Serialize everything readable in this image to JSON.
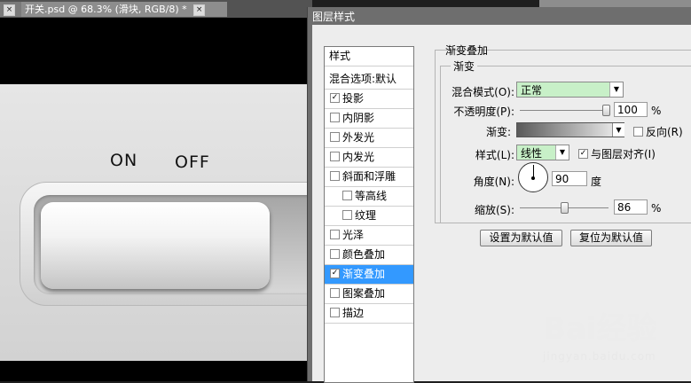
{
  "tabs": [
    {
      "close": "×",
      "label": "",
      "active": false
    },
    {
      "close": "×",
      "label": "开关.psd @ 68.3% (滑块, RGB/8) *",
      "active": true
    }
  ],
  "canvas": {
    "on_label": "ON",
    "off_label": "OFF"
  },
  "dialog": {
    "title": "图层样式",
    "style_list": {
      "header": "样式",
      "blend_default": "混合选项:默认",
      "items": [
        {
          "label": "投影",
          "checked": true
        },
        {
          "label": "内阴影",
          "checked": false
        },
        {
          "label": "外发光",
          "checked": false
        },
        {
          "label": "内发光",
          "checked": false
        },
        {
          "label": "斜面和浮雕",
          "checked": false
        },
        {
          "label": "等高线",
          "checked": false,
          "sub": true
        },
        {
          "label": "纹理",
          "checked": false,
          "sub": true
        },
        {
          "label": "光泽",
          "checked": false
        },
        {
          "label": "颜色叠加",
          "checked": false
        },
        {
          "label": "渐变叠加",
          "checked": true,
          "selected": true
        },
        {
          "label": "图案叠加",
          "checked": false
        },
        {
          "label": "描边",
          "checked": false
        }
      ]
    },
    "panel": {
      "group_title": "渐变叠加",
      "sub_title": "渐变",
      "blend_mode_label": "混合模式(O):",
      "blend_mode_value": "正常",
      "opacity_label": "不透明度(P):",
      "opacity_value": "100",
      "opacity_unit": "%",
      "gradient_label": "渐变:",
      "reverse_label": "反向(R)",
      "style_label": "样式(L):",
      "style_value": "线性",
      "align_label": "与图层对齐(I)",
      "angle_label": "角度(N):",
      "angle_value": "90",
      "angle_unit": "度",
      "scale_label": "缩放(S):",
      "scale_value": "86",
      "scale_unit": "%",
      "set_default": "设置为默认值",
      "reset_default": "复位为默认值"
    }
  },
  "watermark": {
    "brand": "Bai经验",
    "url": "jingyan.baidu.com"
  }
}
